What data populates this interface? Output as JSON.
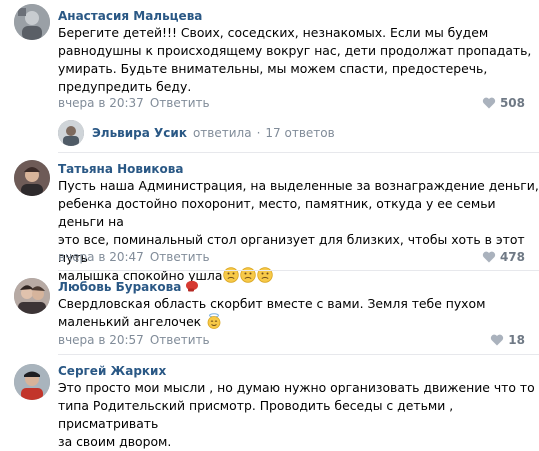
{
  "comments": [
    {
      "author": "Анастасия Мальцева",
      "lines": [
        "Берегите детей!!! Своих, соседских, незнакомых. Если мы будем",
        "равнодушны к происходящему вокруг нас, дети продолжат пропадать,",
        "умирать. Будьте внимательны, мы можем спасти, предостеречь,",
        "предупредить беду."
      ],
      "time": "вчера в 20:37",
      "reply": "Ответить",
      "likes": "508"
    },
    {
      "author": "Татьяна Новикова",
      "lines": [
        "Пусть наша Администрация, на выделенные за вознаграждение деньги,",
        "ребенка достойно похоронит, место, памятник, откуда у ее семьи деньги на",
        "это все, поминальный стол организует для близких, чтобы хоть в этот путь",
        "малышка спокойно ушла"
      ],
      "time": "вчера в 20:47",
      "reply": "Ответить",
      "likes": "478"
    },
    {
      "author": "Любовь Буракова",
      "lines": [
        "Свердловская область скорбит вместе с вами. Земля тебе пухом",
        "маленький ангелочек"
      ],
      "time": "вчера в 20:57",
      "reply": "Ответить",
      "likes": "18"
    },
    {
      "author": "Сергей Жарких",
      "lines": [
        "Это просто мои мысли , но думаю нужно организовать движение что то",
        "типа Родительский присмотр. Проводить беседы с детьми , присматривать",
        "за своим двором."
      ]
    }
  ],
  "thread": {
    "name": "Эльвира Усик",
    "action": "ответила",
    "dot": "·",
    "count": "17 ответов"
  },
  "colors": {
    "author": "#2a5885",
    "meta": "#818c99",
    "likes": "#6f7985"
  },
  "icons": {
    "like": "heart-icon",
    "sad_emoji": "sad-face-emoji",
    "angel_emoji": "angel-emoji",
    "glove": "boxing-glove-icon"
  }
}
